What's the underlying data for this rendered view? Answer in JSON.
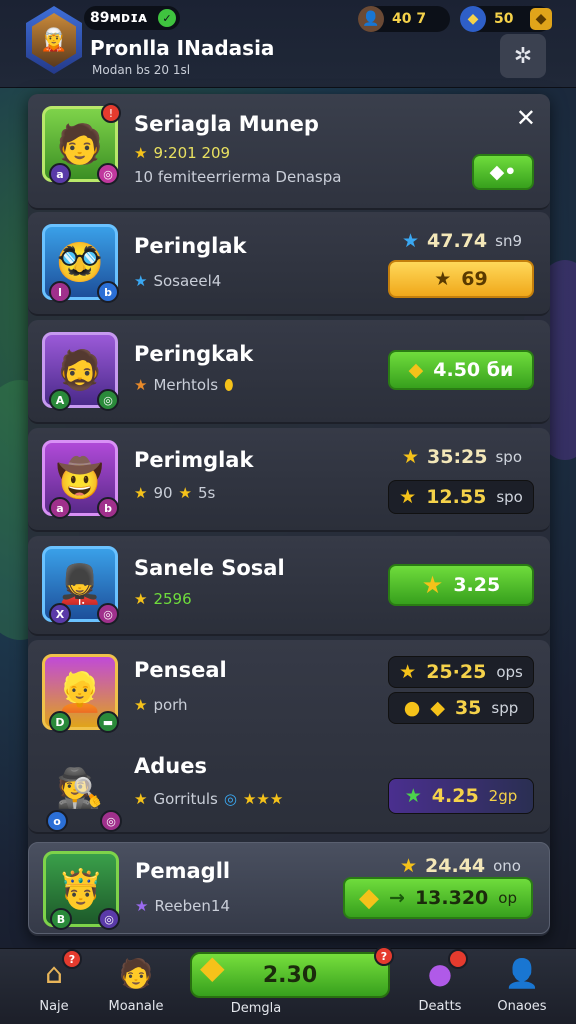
{
  "header": {
    "level_label": "89ᴍᴅɪᴀ",
    "player_name": "Pronlla INadasia",
    "player_sub": "Modan bs 20 1sl",
    "resource_a": "40 7",
    "resource_b": "50"
  },
  "featured": {
    "title": "Seriagla Munep",
    "score": "9:201 209",
    "description": "10 femiteerrierma Denaspa"
  },
  "rows": [
    {
      "title": "Peringlak",
      "sub": "Sosaeel4",
      "value": "47.74",
      "unit": "sn9",
      "button": "69"
    },
    {
      "title": "Peringkak",
      "sub": "Merhtols",
      "button": "4.50 би"
    },
    {
      "title": "Perimglak",
      "sub": "90",
      "sub2": "5s",
      "value": "35:25",
      "unit": "spo",
      "button": "12.55",
      "button_unit": "spo"
    },
    {
      "title": "Sanele Sosal",
      "sub": "2596",
      "button": "3.25"
    },
    {
      "title": "Penseal",
      "sub": "porh",
      "value": "25·25",
      "unit": "ops",
      "button": "35",
      "button_unit": "spp"
    },
    {
      "title": "Adues",
      "sub": "Gorrituls",
      "button": "4.25",
      "button_unit": "2gp"
    },
    {
      "title": "Pemagll",
      "sub": "Reeben14",
      "value": "24.44",
      "unit": "ono",
      "button": "13.320",
      "button_unit": "op"
    }
  ],
  "nav": {
    "home_label": "Naje",
    "heroes_label": "Moanale",
    "main_value": "2.30",
    "main_label": "Demgla",
    "orb_label": "Deatts",
    "profile_label": "Onaoes"
  }
}
